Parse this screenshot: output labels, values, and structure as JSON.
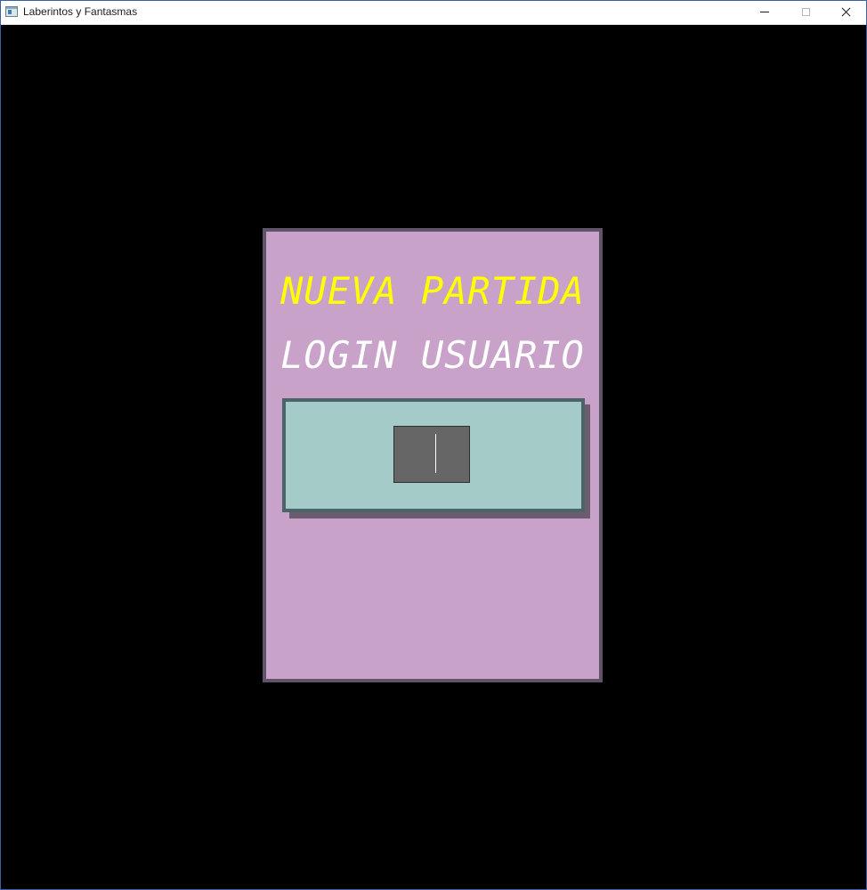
{
  "window": {
    "title": "Laberintos y Fantasmas",
    "controls": {
      "minimize": "",
      "maximize": "",
      "close": ""
    }
  },
  "menu": {
    "new_game": "NUEVA PARTIDA",
    "login": "LOGIN USUARIO"
  },
  "login_input": {
    "value": ""
  },
  "colors": {
    "background": "#000000",
    "panel": "#c8a2c8",
    "panel_border": "#5e5367",
    "selected_option": "#ffff00",
    "option": "#ffffff",
    "input_box": "#a5cbc9",
    "input_border": "#4a6468",
    "text_field": "#666666"
  },
  "icons": {
    "app": "app-window-icon",
    "minimize": "minimize-icon",
    "maximize": "maximize-icon",
    "close": "close-icon"
  }
}
